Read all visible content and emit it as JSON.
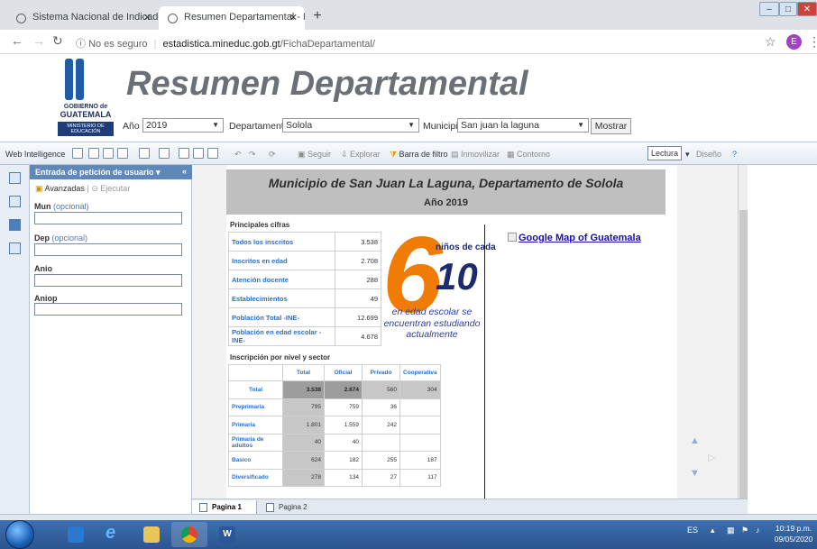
{
  "browser": {
    "tabs": [
      {
        "label": "Sistema Nacional de Indicadores",
        "active": false
      },
      {
        "label": "Resumen Departamental - Minist",
        "active": true
      }
    ],
    "new_tab": "+",
    "url_warning": "No es seguro",
    "url_host": "estadistica.mineduc.gob.gt",
    "url_path": "/FichaDepartamental/",
    "profile_letter": "E"
  },
  "header": {
    "logo_line1": "GOBIERNO de",
    "logo_line2": "GUATEMALA",
    "logo_line3": "MINISTERIO DE EDUCACIÓN",
    "title": "Resumen Departamental"
  },
  "filters": {
    "year_label": "Año",
    "year_value": "2019",
    "dept_label": "Departamento",
    "dept_value": "Solola",
    "muni_label": "Municipio",
    "muni_value": "San juan la laguna",
    "show_button": "Mostrar"
  },
  "toolbar": {
    "app_name": "Web Intelligence",
    "seguir": "Seguir",
    "explorar": "Explorar",
    "barra_filtro": "Barra de filtro",
    "inmovilizar": "Inmovilizar",
    "contorno": "Contorno",
    "lectura": "Lectura",
    "diseno": "Diseño"
  },
  "panel": {
    "title": "Entrada de petición de usuario",
    "avanzadas": "Avanzadas",
    "ejecutar": "Ejecutar",
    "fields": [
      {
        "name": "Mun",
        "optional": "(opcional)"
      },
      {
        "name": "Dep",
        "optional": "(opcional)"
      },
      {
        "name": "Anio",
        "optional": ""
      },
      {
        "name": "Aniop",
        "optional": ""
      }
    ]
  },
  "report": {
    "title": "Municipio de San Juan La Laguna, Departamento de Solola",
    "year": "Año 2019",
    "principales_title": "Principales cifras",
    "principales": [
      {
        "label": "Todos los inscritos",
        "value": "3.538"
      },
      {
        "label": "Inscritos en edad",
        "value": "2.708"
      },
      {
        "label": "Atención docente",
        "value": "288"
      },
      {
        "label": "Establecimientos",
        "value": "49"
      },
      {
        "label": "Población Total -INE-",
        "value": "12.699"
      },
      {
        "label": "Población en edad escolar -INE-",
        "value": "4.678"
      }
    ],
    "ratio_big": "6",
    "ratio_text": "niños de cada",
    "ratio_base": "10",
    "ratio_caption": "en edad escolar se encuentran estudiando actualmente",
    "map_link": "Google Map of Guatemala",
    "nivel_title": "Inscripción por nivel y sector",
    "nivel_headers": [
      "Total",
      "Oficial",
      "Privado",
      "Cooperativa"
    ],
    "nivel_rows": [
      {
        "label": "Total",
        "total": "3.538",
        "oficial": "2.674",
        "privado": "560",
        "coop": "304"
      },
      {
        "label": "Preprimaria",
        "total": "795",
        "oficial": "759",
        "privado": "36",
        "coop": ""
      },
      {
        "label": "Primaria",
        "total": "1.801",
        "oficial": "1.559",
        "privado": "242",
        "coop": ""
      },
      {
        "label": "Primaria de adultos",
        "total": "40",
        "oficial": "40",
        "privado": "",
        "coop": ""
      },
      {
        "label": "Basico",
        "total": "624",
        "oficial": "182",
        "privado": "255",
        "coop": "187"
      },
      {
        "label": "Diversificado",
        "total": "278",
        "oficial": "134",
        "privado": "27",
        "coop": "117"
      }
    ]
  },
  "page_tabs": [
    "Pagina 1",
    "Pagina 2"
  ],
  "taskbar": {
    "lang": "ES",
    "time": "10:19 p.m.",
    "date": "09/05/2020"
  }
}
